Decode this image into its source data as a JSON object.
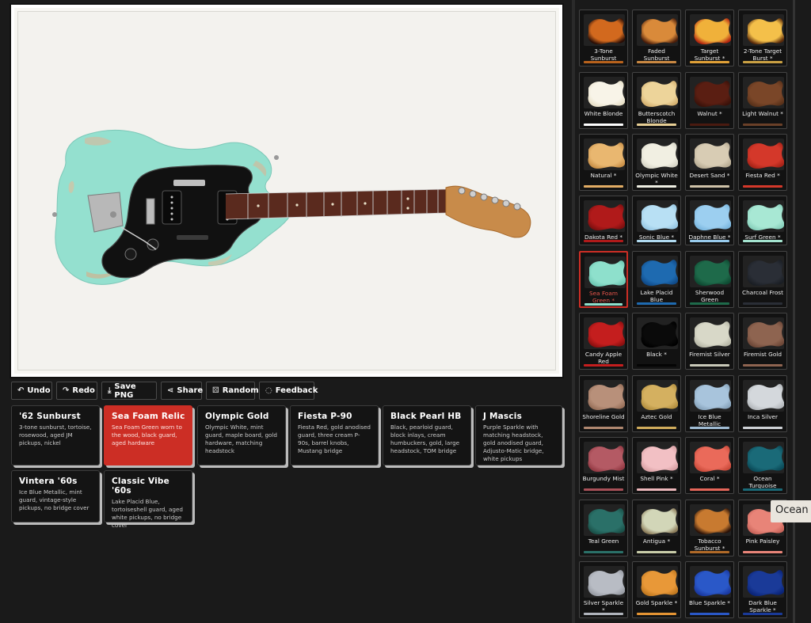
{
  "toolbar": [
    {
      "label": "Undo",
      "icon": "undo-icon",
      "glyph": "↶"
    },
    {
      "label": "Redo",
      "icon": "redo-icon",
      "glyph": "↷"
    },
    {
      "label": "Save PNG",
      "icon": "download-icon",
      "glyph": "⤓"
    },
    {
      "label": "Share",
      "icon": "share-icon",
      "glyph": "⋖"
    },
    {
      "label": "Random",
      "icon": "dice-icon",
      "glyph": "⚄"
    },
    {
      "label": "Feedback",
      "icon": "speech-bubble-icon",
      "glyph": "◌"
    }
  ],
  "presets": [
    {
      "name": "'62 Sunburst",
      "desc": "3-tone sunburst, tortoise, rosewood, aged JM pickups, nickel",
      "active": false
    },
    {
      "name": "Sea Foam Relic",
      "desc": "Sea Foam Green worn to the wood, black guard, aged hardware",
      "active": true
    },
    {
      "name": "Olympic Gold",
      "desc": "Olympic White, mint guard, maple board, gold hardware, matching headstock",
      "active": false
    },
    {
      "name": "Fiesta P-90",
      "desc": "Fiesta Red, gold anodised guard, three cream P-90s, barrel knobs, Mustang bridge",
      "active": false
    },
    {
      "name": "Black Pearl HB",
      "desc": "Black, pearloid guard, block inlays, cream humbuckers, gold, large headstock, TOM bridge",
      "active": false
    },
    {
      "name": "J Mascis",
      "desc": "Purple Sparkle with matching headstock, gold anodised guard, Adjusto-Matic bridge, white pickups",
      "active": false
    },
    {
      "name": "Vintera '60s",
      "desc": "Ice Blue Metallic, mint guard, vintage-style pickups, no bridge cover",
      "active": false
    },
    {
      "name": "Classic Vibe '60s",
      "desc": "Lake Placid Blue, tortoiseshell guard, aged white pickups, no bridge cover",
      "active": false
    }
  ],
  "swatches": [
    {
      "label": "3-Tone Sunburst",
      "color": "#d2691e",
      "edge": "#2a0d05",
      "bar": "#b8621c"
    },
    {
      "label": "Faded Sunburst",
      "color": "#d98a3a",
      "edge": "#4a1d0a",
      "bar": "#c98842"
    },
    {
      "label": "Target Sunburst *",
      "color": "#f0b13a",
      "edge": "#b3250f",
      "bar": "#e0a037"
    },
    {
      "label": "2-Tone Target Burst *",
      "color": "#f4c04a",
      "edge": "#5a2a0a",
      "bar": "#c9a043"
    },
    {
      "label": "White Blonde",
      "color": "#f8f4e8",
      "edge": "#e8e0c8",
      "bar": "#ffffff"
    },
    {
      "label": "Butterscotch Blonde",
      "color": "#edd49a",
      "edge": "#d4b070",
      "bar": "#e8cf95"
    },
    {
      "label": "Walnut *",
      "color": "#5a1e12",
      "edge": "#3a120a",
      "bar": "#4a1a10"
    },
    {
      "label": "Light Walnut *",
      "color": "#7a4628",
      "edge": "#5a321a",
      "bar": "#6a4028"
    },
    {
      "label": "Natural *",
      "color": "#e9b770",
      "edge": "#c99048",
      "bar": "#e1ac64"
    },
    {
      "label": "Olympic White *",
      "color": "#f1efe2",
      "edge": "#d8d6c8",
      "bar": "#eeeee2"
    },
    {
      "label": "Desert Sand *",
      "color": "#d8ccb4",
      "edge": "#b8ac94",
      "bar": "#cfc2a8"
    },
    {
      "label": "Fiesta Red *",
      "color": "#d4382a",
      "edge": "#a82418",
      "bar": "#d4382a"
    },
    {
      "label": "Dakota Red *",
      "color": "#b01a1a",
      "edge": "#801010",
      "bar": "#b01a1a"
    },
    {
      "label": "Sonic Blue *",
      "color": "#b8e0f4",
      "edge": "#98c8e4",
      "bar": "#b0daf0"
    },
    {
      "label": "Daphne Blue *",
      "color": "#9ccff0",
      "edge": "#7cb8e0",
      "bar": "#98cbec"
    },
    {
      "label": "Surf Green *",
      "color": "#a8e8d4",
      "edge": "#88d0bc",
      "bar": "#a4e4d0"
    },
    {
      "label": "Sea Foam Green *",
      "color": "#8ee0cc",
      "edge": "#6ec8b4",
      "bar": "#8ee0cc",
      "selected": true
    },
    {
      "label": "Lake Placid Blue",
      "color": "#1e6ab0",
      "edge": "#104a88",
      "bar": "#1e6ab0"
    },
    {
      "label": "Sherwood Green",
      "color": "#1e6a4a",
      "edge": "#0e4a32",
      "bar": "#1e6a4a"
    },
    {
      "label": "Charcoal Frost",
      "color": "#2a2e36",
      "edge": "#1a1e24",
      "bar": "#2a2e36"
    },
    {
      "label": "Candy Apple Red",
      "color": "#c41e1e",
      "edge": "#8c1010",
      "bar": "#c41e1e"
    },
    {
      "label": "Black *",
      "color": "#0a0a0a",
      "edge": "#000000",
      "bar": "#050505"
    },
    {
      "label": "Firemist Silver",
      "color": "#d8d8c8",
      "edge": "#b8b8a8",
      "bar": "#c8c8b8"
    },
    {
      "label": "Firemist Gold",
      "color": "#8e6450",
      "edge": "#6e4838",
      "bar": "#8e6450"
    },
    {
      "label": "Shoreline Gold",
      "color": "#b8907a",
      "edge": "#98705a",
      "bar": "#b08870"
    },
    {
      "label": "Aztec Gold",
      "color": "#d4b060",
      "edge": "#b49040",
      "bar": "#d0ac5c"
    },
    {
      "label": "Ice Blue Metallic",
      "color": "#a8c4dc",
      "edge": "#88a4bc",
      "bar": "#a0bcd4"
    },
    {
      "label": "Inca Silver",
      "color": "#d4d8dc",
      "edge": "#b4b8bc",
      "bar": "#cfd3d7"
    },
    {
      "label": "Burgundy Mist",
      "color": "#b45a64",
      "edge": "#943a44",
      "bar": "#a85058"
    },
    {
      "label": "Shell Pink *",
      "color": "#f2c0c4",
      "edge": "#d8a0a4",
      "bar": "#eeb8bc"
    },
    {
      "label": "Coral *",
      "color": "#ea6a5a",
      "edge": "#ca4a3a",
      "bar": "#e6665a"
    },
    {
      "label": "Ocean Turquoise",
      "color": "#1a6a78",
      "edge": "#0a4a58",
      "bar": "#1a6a78"
    },
    {
      "label": "Teal Green",
      "color": "#2a7068",
      "edge": "#1a5048",
      "bar": "#2a7068"
    },
    {
      "label": "Antigua *",
      "color": "#d2d6b8",
      "edge": "#8a7a58",
      "bar": "#c8cca8"
    },
    {
      "label": "Tobacco Sunburst *",
      "color": "#c87a30",
      "edge": "#2a1208",
      "bar": "#b06a28"
    },
    {
      "label": "Pink Paisley",
      "color": "#e88478",
      "edge": "#c8645a",
      "bar": "#e88478"
    },
    {
      "label": "Silver Sparkle *",
      "color": "#b8bcc4",
      "edge": "#989ca4",
      "bar": "#b0b4bc"
    },
    {
      "label": "Gold Sparkle *",
      "color": "#e89838",
      "edge": "#c07820",
      "bar": "#e49434"
    },
    {
      "label": "Blue Sparkle *",
      "color": "#2a58c8",
      "edge": "#1a38a0",
      "bar": "#2a58c8"
    },
    {
      "label": "Dark Blue Sparkle *",
      "color": "#1a3a98",
      "edge": "#0a2478",
      "bar": "#1a3a98"
    }
  ],
  "tooltip": "Ocean Turquoise"
}
